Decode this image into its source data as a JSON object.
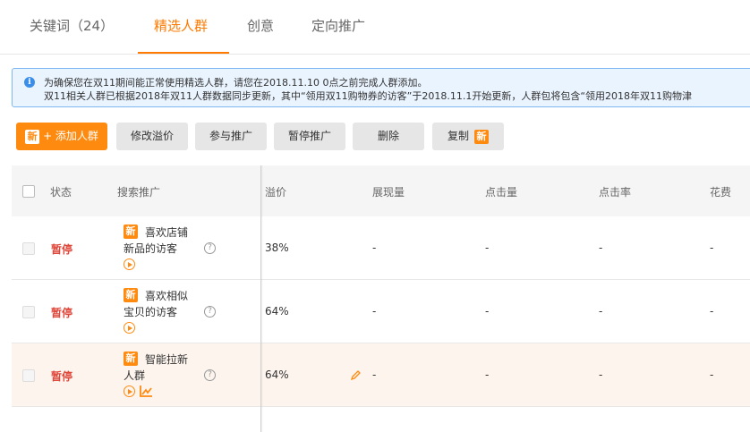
{
  "tabs": [
    {
      "label": "关键词（24）"
    },
    {
      "label": "精选人群"
    },
    {
      "label": "创意"
    },
    {
      "label": "定向推广"
    }
  ],
  "notice": {
    "line1": "为确保您在双11期间能正常使用精选人群，请您在2018.11.10 0点之前完成人群添加。",
    "line2": "双11相关人群已根据2018年双11人群数据同步更新，其中“领用双11购物券的访客”于2018.11.1开始更新，人群包将包含“领用2018年双11购物津"
  },
  "toolbar": {
    "new_badge": "新",
    "add_label": "+ 添加人群",
    "modify_premium": "修改溢价",
    "join_promo": "参与推广",
    "pause_promo": "暂停推广",
    "delete": "删除",
    "copy": "复制"
  },
  "table": {
    "headers": {
      "status": "状态",
      "search_promo": "搜索推广",
      "premium": "溢价",
      "impressions": "展现量",
      "clicks": "点击量",
      "ctr": "点击率",
      "cost": "花费"
    },
    "rows": [
      {
        "status": "暂停",
        "badge": "新",
        "name": "喜欢店铺新品的访客",
        "premium": "38%",
        "impressions": "-",
        "clicks": "-",
        "ctr": "-",
        "cost": "-"
      },
      {
        "status": "暂停",
        "badge": "新",
        "name": "喜欢相似宝贝的访客",
        "premium": "64%",
        "impressions": "-",
        "clicks": "-",
        "ctr": "-",
        "cost": "-"
      },
      {
        "status": "暂停",
        "badge": "新",
        "name": "智能拉新人群",
        "premium": "64%",
        "impressions": "-",
        "clicks": "-",
        "ctr": "-",
        "cost": "-"
      }
    ]
  },
  "colors": {
    "accent": "#ff7a00",
    "button_orange": "#ff8a10",
    "status_paused": "#e0473b",
    "notice_bg": "#eaf4ff",
    "notice_border": "#7fb8f0",
    "info_icon": "#3b8ee8",
    "highlight_row": "#fdf4ee"
  },
  "icons": {
    "info": "info-icon",
    "help": "help-circle-icon",
    "play": "play-circle-icon",
    "trend": "trend-chart-icon",
    "edit": "pencil-icon"
  }
}
